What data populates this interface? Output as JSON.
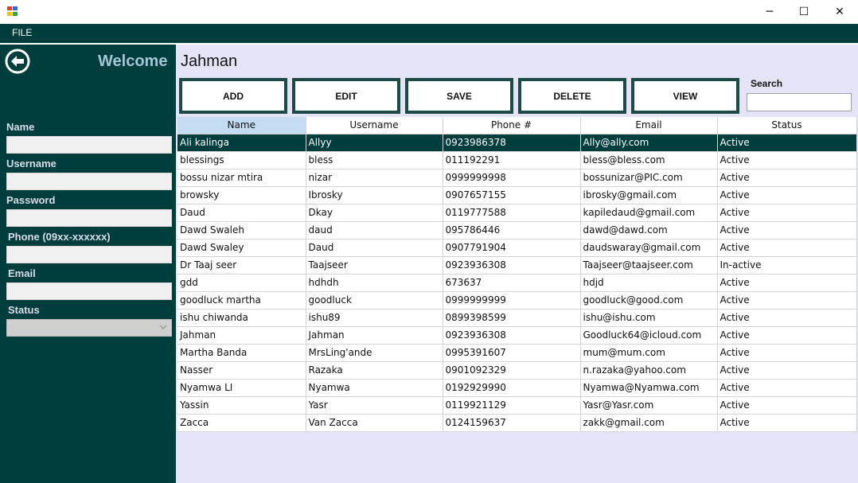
{
  "window": {
    "minimize_glyph": "─",
    "maximize_glyph": "☐",
    "close_glyph": "✕"
  },
  "menu": {
    "file_label": "FILE"
  },
  "sidebar": {
    "welcome": "Welcome",
    "fields": [
      {
        "label": "Name",
        "value": ""
      },
      {
        "label": "Username",
        "value": ""
      },
      {
        "label": "Password",
        "value": ""
      },
      {
        "label": "Phone (09xx-xxxxxx)",
        "value": ""
      },
      {
        "label": "Email",
        "value": ""
      },
      {
        "label": "Status",
        "value": ""
      }
    ]
  },
  "main": {
    "title": "Jahman",
    "buttons": {
      "add": "ADD",
      "edit": "EDIT",
      "save": "SAVE",
      "delete": "DELETE",
      "view": "VIEW"
    },
    "search": {
      "label": "Search",
      "value": ""
    }
  },
  "table": {
    "columns": [
      "Name",
      "Username",
      "Phone #",
      "Email",
      "Status"
    ],
    "selected_row": 0,
    "rows": [
      [
        "Ali kalinga",
        "Allyy",
        "0923986378",
        "Ally@ally.com",
        "Active"
      ],
      [
        "blessings",
        "bless",
        "011192291",
        "bless@bless.com",
        "Active"
      ],
      [
        "bossu nizar mtira",
        "nizar",
        "0999999998",
        "bossunizar@PIC.com",
        "Active"
      ],
      [
        "browsky",
        "Ibrosky",
        "0907657155",
        "ibrosky@gmail.com",
        "Active"
      ],
      [
        "Daud",
        "Dkay",
        "0119777588",
        "kapiledaud@gmail.com",
        "Active"
      ],
      [
        "Dawd Swaleh",
        "daud",
        "095786446",
        "dawd@dawd.com",
        "Active"
      ],
      [
        "Dawd Swaley",
        "Daud",
        "0907791904",
        "daudswaray@gmail.com",
        "Active"
      ],
      [
        "Dr Taaj seer",
        "Taajseer",
        "0923936308",
        "Taajseer@taajseer.com",
        "In-active"
      ],
      [
        "gdd",
        "hdhdh",
        "673637",
        "hdjd",
        "Active"
      ],
      [
        "goodluck martha",
        "goodluck",
        "0999999999",
        "goodluck@good.com",
        "Active"
      ],
      [
        "ishu  chiwanda",
        "ishu89",
        "0899398599",
        "ishu@ishu.com",
        "Active"
      ],
      [
        "Jahman",
        "Jahman",
        "0923936308",
        "Goodluck64@icloud.com",
        "Active"
      ],
      [
        "Martha Banda",
        "MrsLing'ande",
        "0995391607",
        "mum@mum.com",
        "Active"
      ],
      [
        "Nasser",
        "Razaka",
        "0901092329",
        "n.razaka@yahoo.com",
        "Active"
      ],
      [
        "Nyamwa LI",
        "Nyamwa",
        "0192929990",
        "Nyamwa@Nyamwa.com",
        "Active"
      ],
      [
        "Yassin",
        "Yasr",
        "0119921129",
        "Yasr@Yasr.com",
        "Active"
      ],
      [
        "Zacca",
        "Van Zacca",
        "0124159637",
        "zakk@gmail.com",
        "Active"
      ]
    ]
  },
  "colors": {
    "panel": "#003e3e",
    "main_bg": "#e4e4f6",
    "selected_row": "#003e3e",
    "sorted_header": "#c3dcf2",
    "welcome_text": "#a6c4d8"
  }
}
